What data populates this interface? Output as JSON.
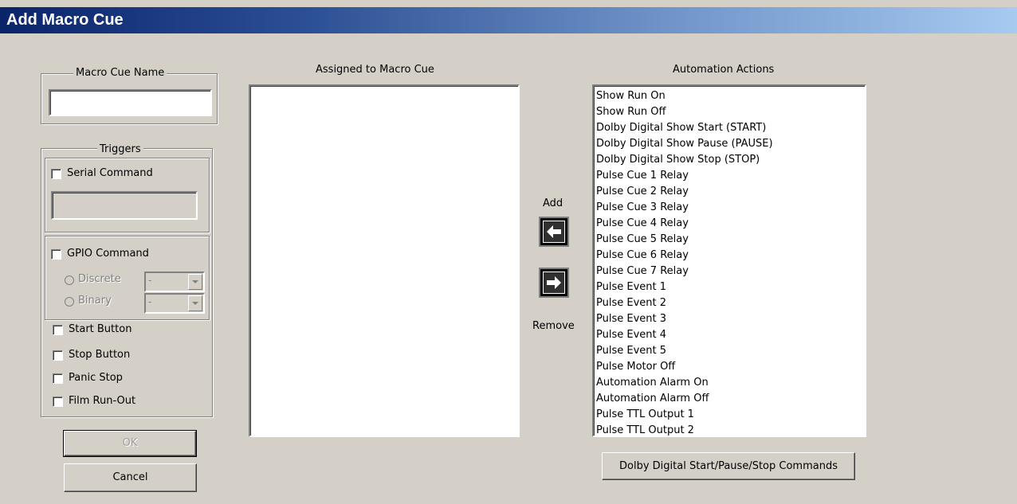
{
  "window": {
    "title": "Add Macro Cue"
  },
  "name_group": {
    "label": "Macro Cue Name",
    "value": ""
  },
  "triggers": {
    "label": "Triggers",
    "serial": {
      "label": "Serial Command",
      "checked": false,
      "value": ""
    },
    "gpio": {
      "label": "GPIO Command",
      "checked": false,
      "discrete_label": "Discrete",
      "discrete_value": "-",
      "binary_label": "Binary",
      "binary_value": "-"
    },
    "start_button": "Start Button",
    "stop_button": "Stop Button",
    "panic_stop": "Panic Stop",
    "film_runout": "Film Run-Out"
  },
  "buttons": {
    "ok": "OK",
    "cancel": "Cancel",
    "add": "Add",
    "remove": "Remove",
    "dolby_commands": "Dolby Digital Start/Pause/Stop Commands"
  },
  "assigned": {
    "header": "Assigned to Macro Cue",
    "items": []
  },
  "actions": {
    "header": "Automation Actions",
    "items": [
      "Show Run On",
      "Show Run Off",
      "Dolby Digital Show Start (START)",
      "Dolby Digital Show Pause (PAUSE)",
      "Dolby Digital Show Stop (STOP)",
      "Pulse Cue 1 Relay",
      "Pulse Cue 2 Relay",
      "Pulse Cue 3 Relay",
      "Pulse Cue 4 Relay",
      "Pulse Cue 5 Relay",
      "Pulse Cue 6 Relay",
      "Pulse Cue 7 Relay",
      "Pulse Event 1",
      "Pulse Event 2",
      "Pulse Event 3",
      "Pulse Event 4",
      "Pulse Event 5",
      "Pulse Motor Off",
      "Automation Alarm On",
      "Automation Alarm Off",
      "Pulse TTL Output 1",
      "Pulse TTL Output 2"
    ]
  },
  "colors": {
    "face": "#d4d0c8",
    "title_start": "#0a246a",
    "title_end": "#a6caf0"
  }
}
